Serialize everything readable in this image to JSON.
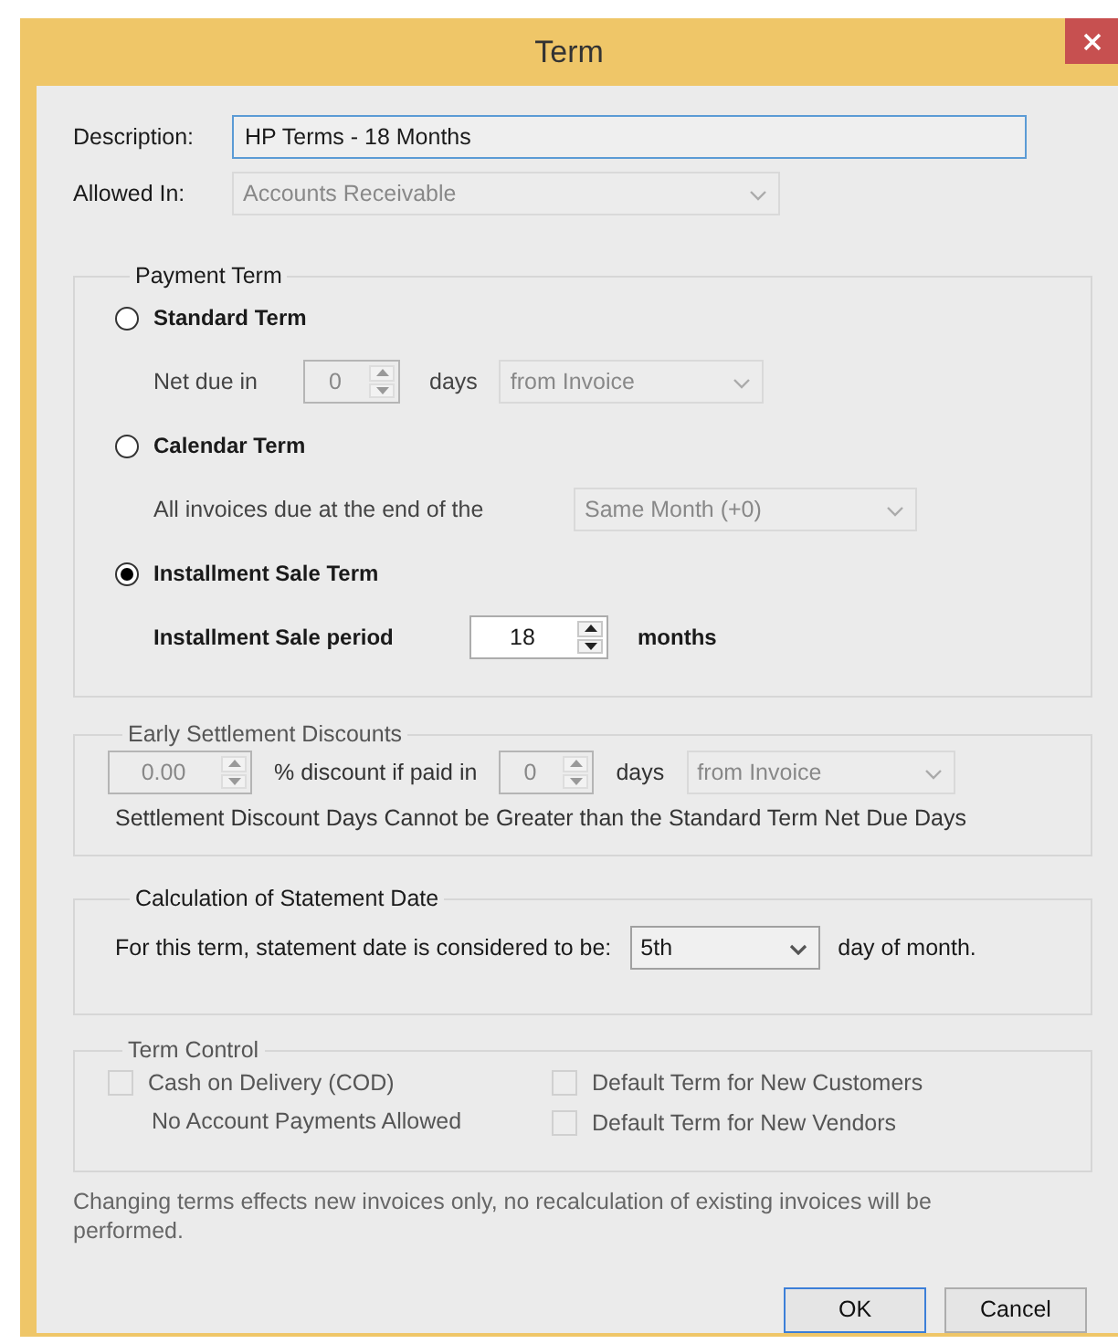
{
  "window": {
    "title": "Term"
  },
  "description": {
    "label": "Description:",
    "value": "HP Terms - 18 Months",
    "focused": true
  },
  "allowed_in": {
    "label": "Allowed In:",
    "value": "Accounts Receivable",
    "disabled": true
  },
  "payment_term": {
    "title": "Payment Term",
    "options": [
      {
        "label": "Standard Term",
        "selected": false,
        "detail": {
          "kind": "spinner_select",
          "label": "Net due in",
          "spinner": "0",
          "unit": "days",
          "select": "from Invoice",
          "disabled": true
        }
      },
      {
        "label": "Calendar Term",
        "selected": false,
        "detail": {
          "kind": "select",
          "label": "All invoices due at the end of the",
          "select": "Same Month (+0)",
          "disabled": true
        }
      },
      {
        "label": "Installment Sale Term",
        "selected": true,
        "detail": {
          "kind": "spinner",
          "label": "Installment Sale period",
          "spinner": "18",
          "unit": "months",
          "disabled": false
        }
      }
    ]
  },
  "early_settlement": {
    "title": "Early Settlement Discounts",
    "disabled": true,
    "percent": "0.00",
    "percent_label": "% discount if paid in",
    "days": "0",
    "days_label": "days",
    "select": "from Invoice",
    "note": "Settlement Discount Days Cannot be Greater than the Standard Term Net Due Days"
  },
  "statement_date": {
    "title": "Calculation of Statement Date",
    "label": "For this term, statement date is considered to be:",
    "select": "5th",
    "suffix": "day of month."
  },
  "term_control": {
    "title": "Term Control",
    "disabled": true,
    "checks": [
      {
        "label": "Cash on Delivery (COD)",
        "checked": false
      },
      {
        "label": "Default Term for New Customers",
        "checked": false
      },
      {
        "label": "Default Term for New Vendors",
        "checked": false
      }
    ],
    "cod_note": "No Account Payments Allowed"
  },
  "footer_note": "Changing terms effects new invoices only, no recalculation of existing invoices will be performed.",
  "buttons": [
    {
      "label": "OK",
      "default": true
    },
    {
      "label": "Cancel",
      "default": false
    }
  ]
}
